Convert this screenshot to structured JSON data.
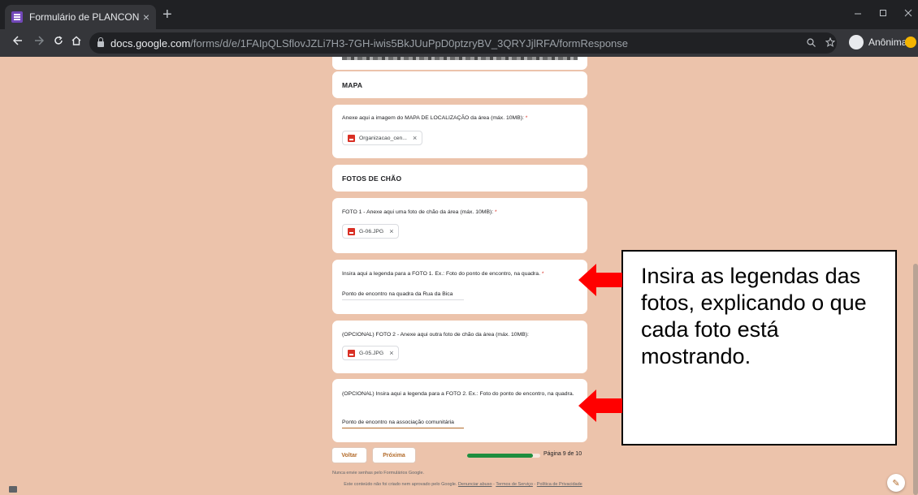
{
  "browser": {
    "tab_title": "Formulário de PLANCON",
    "tab_close": "×",
    "new_tab": "+",
    "url_host": "docs.google.com",
    "url_path": "/forms/d/e/1FAIpQLSflovJZLi7H3-7GH-iwis5BkJUuPpD0ptzryBV_3QRYJjlRFA/formResponse",
    "profile_label": "Anônima",
    "icons": [
      "back-icon",
      "forward-icon",
      "reload-icon",
      "home-icon",
      "lock-icon",
      "zoom-icon",
      "star-icon",
      "minimize-icon",
      "maximize-icon",
      "close-icon"
    ]
  },
  "form": {
    "section_mapa": "MAPA",
    "q_mapa": "Anexe aqui a imagem do MAPA DE LOCALIZAÇÃO da área (máx. 10MB):",
    "q_mapa_file": "Organizacao_cen...",
    "section_fotos": "FOTOS DE CHÃO",
    "q_foto1": "FOTO 1 - Anexe aqui uma foto de chão da área (máx. 10MB):",
    "q_foto1_file": "G-06.JPG",
    "q_leg1": "Insira aqui a legenda para a FOTO 1. Ex.: Foto do ponto de encontro, na quadra.",
    "q_leg1_answer": "Ponto de encontro na quadra da Rua da Bica",
    "q_foto2": "(OPCIONAL) FOTO 2 - Anexe aqui outra foto de chão da área (máx. 10MB):",
    "q_foto2_file": "G-05.JPG",
    "q_leg2": "(OPCIONAL) Insira aqui a legenda para a FOTO 2. Ex.: Foto do ponto de encontro, na quadra.",
    "q_leg2_answer": "Ponto de encontro na associação comunitária",
    "required_mark": "*",
    "remove_mark": "×",
    "back_label": "Voltar",
    "next_label": "Próxima",
    "page_label": "Página 9 de 10",
    "progress": 0.9,
    "footer_warning": "Nunca envie senhas pelo Formulários Google.",
    "footer_disclaimer": "Este conteúdo não foi criado nem aprovado pelo Google.",
    "footer_link_abuse": "Denunciar abuso",
    "footer_link_terms": "Termos de Serviço",
    "footer_link_privacy": "Política de Privacidade",
    "footer_sep": "-",
    "edit_icon": "✎"
  },
  "annotation": {
    "text": "Insira as legendas das fotos, explicando o que cada foto está mostrando.",
    "arrow_color": "#ff0000"
  }
}
